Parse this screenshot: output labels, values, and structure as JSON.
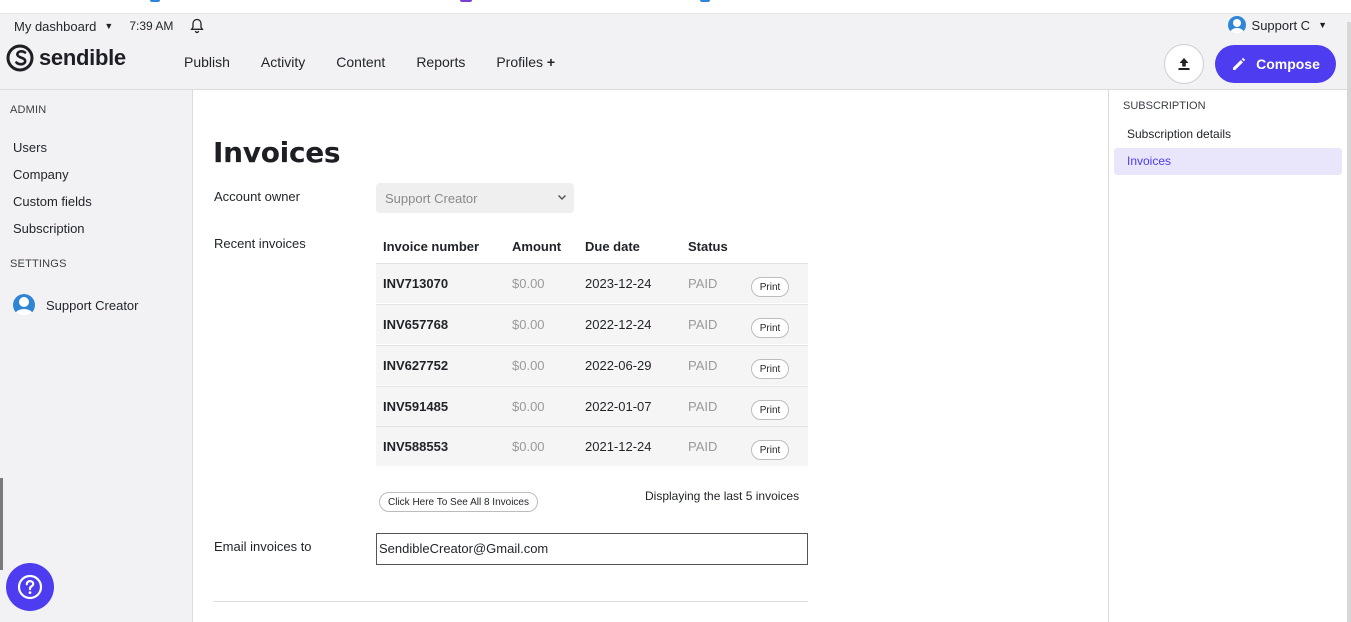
{
  "header": {
    "dashboard_label": "My dashboard",
    "time": "7:39 AM",
    "user_name": "Support C",
    "logo_text": "sendible",
    "nav": [
      "Publish",
      "Activity",
      "Content",
      "Reports",
      "Profiles"
    ],
    "nav_plus": "+",
    "compose_label": "Compose",
    "brand_color": "#4d3cf0"
  },
  "sidebar": {
    "admin_heading": "ADMIN",
    "admin_items": [
      "Users",
      "Company",
      "Custom fields",
      "Subscription"
    ],
    "settings_heading": "SETTINGS",
    "settings_user": "Support Creator"
  },
  "main": {
    "title": "Invoices",
    "account_owner_label": "Account owner",
    "account_owner_value": "Support Creator",
    "recent_label": "Recent invoices",
    "columns": [
      "Invoice number",
      "Amount",
      "Due date",
      "Status"
    ],
    "invoices": [
      {
        "number": "INV713070",
        "amount": "$0.00",
        "due": "2023-12-24",
        "status": "PAID",
        "action": "Print"
      },
      {
        "number": "INV657768",
        "amount": "$0.00",
        "due": "2022-12-24",
        "status": "PAID",
        "action": "Print"
      },
      {
        "number": "INV627752",
        "amount": "$0.00",
        "due": "2022-06-29",
        "status": "PAID",
        "action": "Print"
      },
      {
        "number": "INV591485",
        "amount": "$0.00",
        "due": "2022-01-07",
        "status": "PAID",
        "action": "Print"
      },
      {
        "number": "INV588553",
        "amount": "$0.00",
        "due": "2021-12-24",
        "status": "PAID",
        "action": "Print"
      }
    ],
    "see_all_label": "Click Here To See All 8 Invoices",
    "display_note": "Displaying the last 5 invoices",
    "email_label": "Email invoices to",
    "email_value": "SendibleCreator@Gmail.com"
  },
  "rightbar": {
    "heading": "SUBSCRIPTION",
    "items": [
      "Subscription details",
      "Invoices"
    ],
    "active_item": "Invoices"
  }
}
